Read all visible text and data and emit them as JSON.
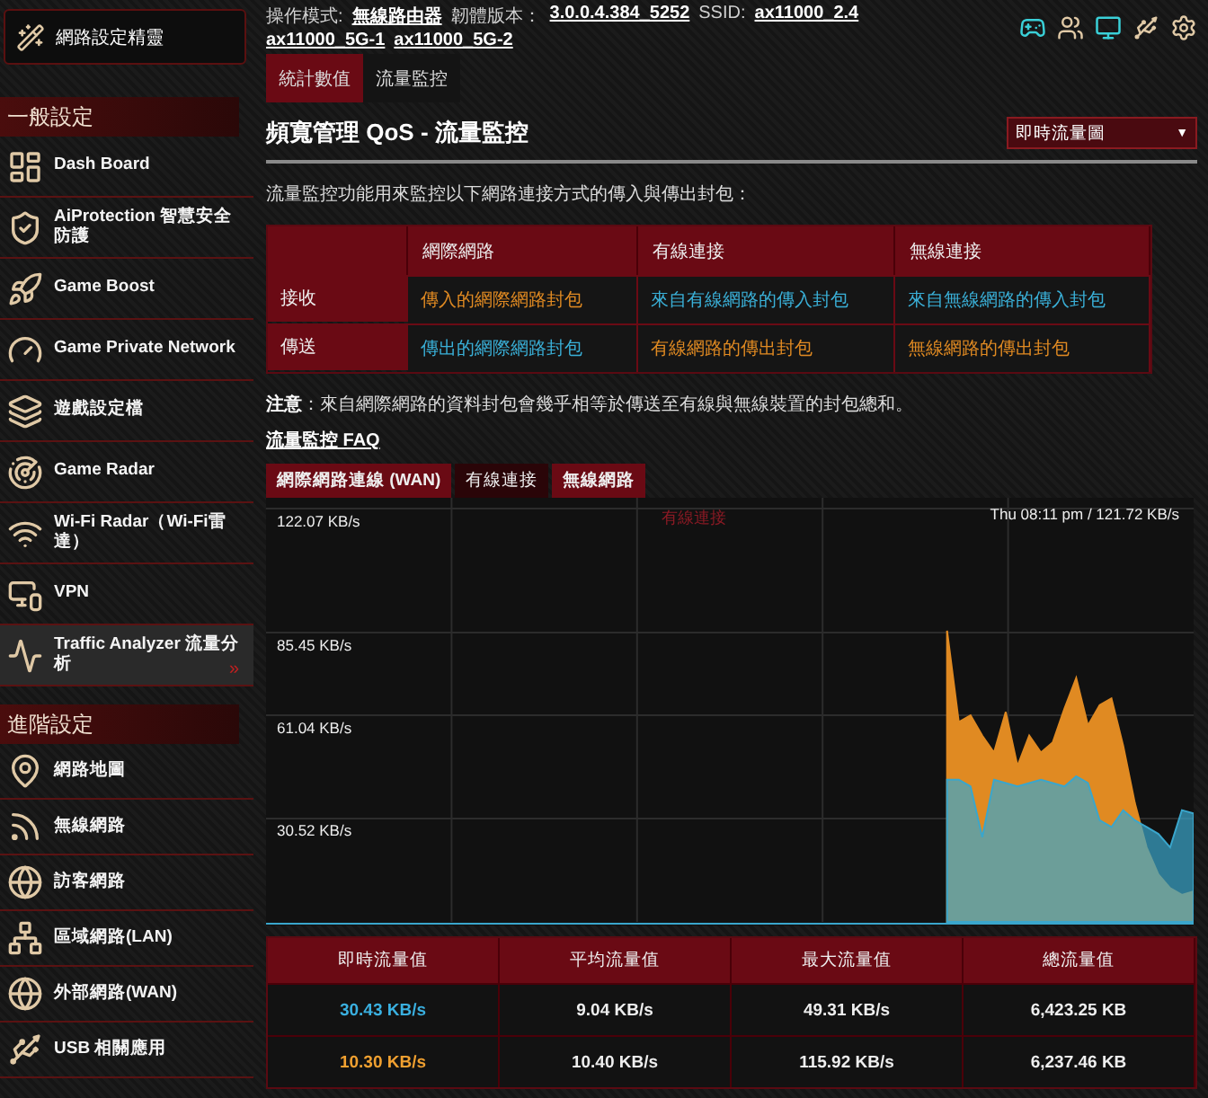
{
  "wizard_button": {
    "label": "網路設定精靈"
  },
  "sidebar": {
    "sections": [
      {
        "title": "一般設定",
        "items": [
          {
            "label": "Dash Board",
            "selected": false
          },
          {
            "label": "AiProtection 智慧安全防護",
            "selected": false
          },
          {
            "label": "Game Boost",
            "selected": false
          },
          {
            "label": "Game Private Network",
            "selected": false
          },
          {
            "label": "遊戲設定檔",
            "selected": false
          },
          {
            "label": "Game Radar",
            "selected": false
          },
          {
            "label": "Wi-Fi Radar（Wi-Fi雷達）",
            "selected": false
          },
          {
            "label": "VPN",
            "selected": false
          },
          {
            "label": "Traffic Analyzer 流量分析",
            "selected": true,
            "arrow": "»"
          }
        ]
      },
      {
        "title": "進階設定",
        "items": [
          {
            "label": "網路地圖",
            "selected": false
          },
          {
            "label": "無線網路",
            "selected": false
          },
          {
            "label": "訪客網路",
            "selected": false
          },
          {
            "label": "區域網路(LAN)",
            "selected": false
          },
          {
            "label": "外部網路(WAN)",
            "selected": false
          },
          {
            "label": "USB 相關應用",
            "selected": false
          }
        ]
      }
    ]
  },
  "status_line": [
    {
      "kind": "label",
      "text": "操作模式:"
    },
    {
      "kind": "link",
      "text": "無線路由器"
    },
    {
      "kind": "label",
      "text": "韌體版本："
    },
    {
      "kind": "link",
      "text": "3.0.0.4.384_5252"
    },
    {
      "kind": "label",
      "text": "SSID:"
    },
    {
      "kind": "link",
      "text": "ax11000_2.4"
    },
    {
      "kind": "link",
      "text": "ax11000_5G-1"
    },
    {
      "kind": "link",
      "text": "ax11000_5G-2"
    }
  ],
  "header_icons": [
    {
      "active": true
    },
    {
      "active": false
    },
    {
      "active": true
    },
    {
      "active": false
    },
    {
      "active": false
    }
  ],
  "tabs": [
    {
      "label": "統計數值",
      "selected": true
    },
    {
      "label": "流量監控",
      "selected": false
    }
  ],
  "page_title": "頻寬管理 QoS - 流量監控",
  "view_select": {
    "value": "即時流量圖",
    "caret": "▼"
  },
  "description": "流量監控功能用來監控以下網路連接方式的傳入與傳出封包：",
  "legend_table": {
    "columns": [
      "網際網路",
      "有線連接",
      "無線連接"
    ],
    "rows": [
      {
        "header": "接收",
        "cells": [
          {
            "text": "傳入的網際網路封包",
            "color": "#e08a22"
          },
          {
            "text": "來自有線網路的傳入封包",
            "color": "#3ab0d8"
          },
          {
            "text": "來自無線網路的傳入封包",
            "color": "#3ab0d8"
          }
        ]
      },
      {
        "header": "傳送",
        "cells": [
          {
            "text": "傳出的網際網路封包",
            "color": "#3ab0d8"
          },
          {
            "text": "有線網路的傳出封包",
            "color": "#e08a22"
          },
          {
            "text": "無線網路的傳出封包",
            "color": "#e08a22"
          }
        ]
      }
    ]
  },
  "note": "**注意**：來自網際網路的資料封包會幾乎相等於傳送至有線與無線裝置的封包總和。",
  "faq_link": "流量監控 FAQ",
  "chart": {
    "tabs": [
      {
        "label": "網際網路連線 (WAN)",
        "selected": false
      },
      {
        "label": "有線連接",
        "selected": true
      },
      {
        "label": "無線網路",
        "selected": false
      }
    ],
    "readout": "Thu 08:11 pm / 121.72 KB/s",
    "chart_data": {
      "type": "area",
      "title": "有線連接",
      "ylim": [
        0,
        122.07
      ],
      "grid": true,
      "yticks": [
        {
          "value": 30.52,
          "label": "30.52 KB/s"
        },
        {
          "value": 61.04,
          "label": "61.04 KB/s"
        },
        {
          "value": 85.45,
          "label": "85.45 KB/s"
        },
        {
          "value": 122.07,
          "label": "122.07 KB/s"
        }
      ],
      "series": [
        {
          "color": "#e08a22",
          "values": [
            null,
            null,
            null,
            null,
            null,
            null,
            null,
            null,
            null,
            null,
            null,
            null,
            null,
            null,
            null,
            null,
            null,
            null,
            null,
            null,
            null,
            null,
            null,
            null,
            null,
            null,
            null,
            null,
            null,
            null,
            null,
            null,
            null,
            null,
            null,
            null,
            null,
            null,
            null,
            null,
            null,
            null,
            null,
            null,
            null,
            null,
            null,
            null,
            null,
            null,
            null,
            null,
            null,
            null,
            null,
            null,
            null,
            null,
            86,
            59,
            61,
            55,
            50,
            62,
            46,
            55,
            50,
            53,
            63,
            72,
            58,
            64,
            66,
            52,
            35,
            22,
            14,
            10,
            8,
            9
          ]
        },
        {
          "color": "#3aa6cc",
          "values": [
            null,
            null,
            null,
            null,
            null,
            null,
            null,
            null,
            null,
            null,
            null,
            null,
            null,
            null,
            null,
            null,
            null,
            null,
            null,
            null,
            null,
            null,
            null,
            null,
            null,
            null,
            null,
            null,
            null,
            null,
            null,
            null,
            null,
            null,
            null,
            null,
            null,
            null,
            null,
            null,
            null,
            null,
            null,
            null,
            null,
            null,
            null,
            null,
            null,
            null,
            null,
            null,
            null,
            null,
            null,
            null,
            null,
            null,
            42,
            42,
            40,
            25,
            42,
            41,
            40,
            41,
            42,
            41,
            40,
            43,
            41,
            30,
            28,
            33,
            30,
            28,
            26,
            22,
            33,
            32
          ]
        }
      ]
    }
  },
  "stats_table": {
    "columns": [
      "即時流量值",
      "平均流量值",
      "最大流量值",
      "總流量值"
    ],
    "rows": [
      {
        "color": "#3ab0e0",
        "cells": [
          "30.43 KB/s",
          "9.04 KB/s",
          "49.31 KB/s",
          "6,423.25 KB"
        ]
      },
      {
        "color": "#f0a030",
        "cells": [
          "10.30 KB/s",
          "10.40 KB/s",
          "115.92 KB/s",
          "6,237.46 KB"
        ]
      }
    ]
  }
}
